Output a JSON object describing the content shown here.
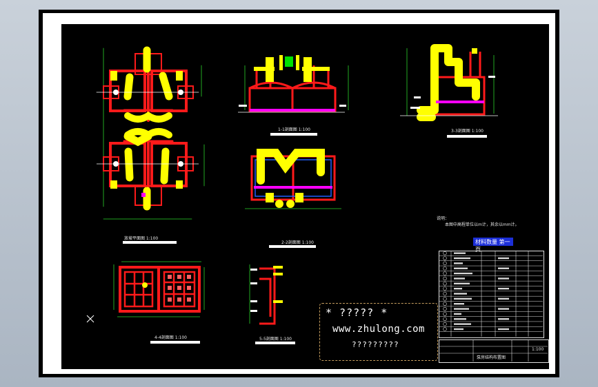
{
  "drawing": {
    "captions": {
      "view1": "放坡平面图  1:100",
      "view2": "1-1剖面图  1:100",
      "view3": "2-2剖面图  1:100",
      "view4": "3-3剖面图  1:100",
      "view5": "4-4剖面图  1:100",
      "view6": "5-5剖面图  1:100"
    },
    "notes": {
      "heading": "说明：",
      "line1": "本图中高程单位以m计，其余以mm计。"
    },
    "title_tag": "材料数量  第一页",
    "title_block": {
      "name": "泵房结构布置图",
      "scale": "1:100"
    }
  },
  "watermark": {
    "line1": "* ????? *",
    "line2": "www.zhulong.com",
    "line3": "?????????"
  },
  "colors": {
    "background_top": "#c9d1da",
    "sheet": "#000000",
    "border": "#ffffff",
    "structure": "#ff1a1a",
    "highlight": "#ffff00",
    "accent_green": "#00e000",
    "accent_magenta": "#ff00ff",
    "blue_tag": "#1c2fd8"
  }
}
